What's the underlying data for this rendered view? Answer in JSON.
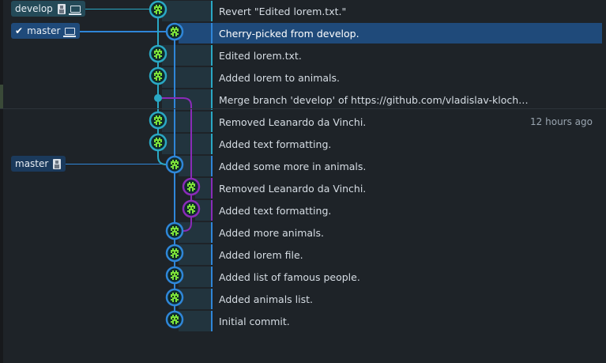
{
  "branches": {
    "develop": {
      "label": "develop"
    },
    "master_local": {
      "label": "master"
    },
    "master_remote": {
      "label": "master"
    }
  },
  "commits": [
    {
      "message": "Revert \"Edited lorem.txt.\"",
      "time": ""
    },
    {
      "message": "Cherry-picked from develop.",
      "time": "",
      "selected": true
    },
    {
      "message": "Edited lorem.txt.",
      "time": ""
    },
    {
      "message": "Added lorem to animals.",
      "time": ""
    },
    {
      "message": "Merge branch 'develop' of https://github.com/vladislav-klochkov/git-training into d...",
      "time": ""
    },
    {
      "message": "Removed Leanardo da Vinchi.",
      "time": "12 hours ago"
    },
    {
      "message": "Added text formatting.",
      "time": ""
    },
    {
      "message": "Added some more in animals.",
      "time": ""
    },
    {
      "message": "Removed Leanardo da Vinchi.",
      "time": ""
    },
    {
      "message": "Added text formatting.",
      "time": ""
    },
    {
      "message": "Added more animals.",
      "time": ""
    },
    {
      "message": "Added lorem file.",
      "time": ""
    },
    {
      "message": "Added list of famous people.",
      "time": ""
    },
    {
      "message": "Added animals list.",
      "time": ""
    },
    {
      "message": "Initial commit.",
      "time": ""
    }
  ],
  "colors": {
    "lane_teal": "#2aa8c4",
    "lane_blue": "#2f86d8",
    "lane_purple": "#8a2bb8",
    "selected_row": "#1f4a7a",
    "avatar_green": "#7be03a"
  },
  "icons": {
    "checkout": "check-icon",
    "local": "laptop-icon",
    "remote": "remote-avatar-icon",
    "author": "pixel-avatar-icon"
  }
}
